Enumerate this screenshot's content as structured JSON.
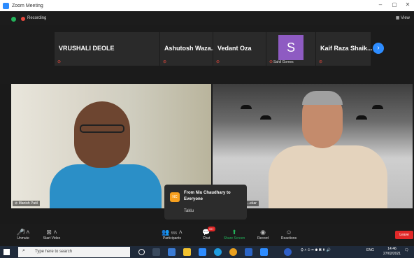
{
  "window": {
    "title": "Zoom Meeting",
    "controls": {
      "minimize": "–",
      "maximize": "▢",
      "close": "✕"
    }
  },
  "meeting_bar": {
    "recording_label": "Recording",
    "view_label": "View"
  },
  "participants_strip": [
    {
      "name": "VRUSHALI DEOLE"
    },
    {
      "name": "Ashutosh  Waza..."
    },
    {
      "name": "Vedant Oza"
    },
    {
      "avatar_letter": "S",
      "name": "Sahil Gomes"
    },
    {
      "name": "Kaif Raza Shaik..."
    }
  ],
  "videos": [
    {
      "label": "Manish Patil"
    },
    {
      "label": "...ekar"
    }
  ],
  "chat_popup": {
    "badge": "NC",
    "from": "From Niu Chaudhary to Everyone",
    "message": "Taklu"
  },
  "toolbar": {
    "unmute": "Unmute",
    "start_video": "Start Video",
    "participants": "Participants",
    "participants_count": "555",
    "chat": "Chat",
    "chat_badge": "99+",
    "share_screen": "Share Screen",
    "record": "Record",
    "reactions": "Reactions",
    "leave": "Leave"
  },
  "taskbar": {
    "search_placeholder": "Type here to search",
    "language": "ENG",
    "time": "14:46",
    "date": "27/02/2021"
  },
  "colors": {
    "accent": "#2d8cff",
    "leave": "#e02828",
    "share": "#23b35b",
    "avatar": "#8e5bc2"
  }
}
